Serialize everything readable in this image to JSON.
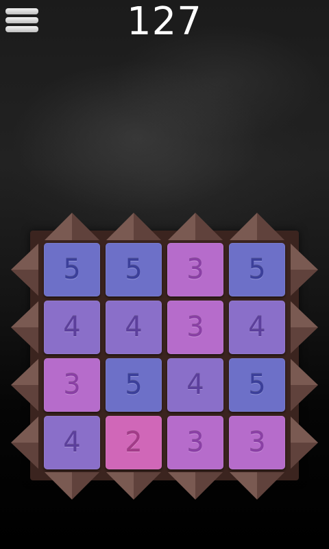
{
  "score": "127",
  "colors": {
    "frame": "#3b241f",
    "arrow": "#7a5a52",
    "arrow_dark": "#4a302a"
  },
  "board": {
    "rows": [
      [
        {
          "value": "5",
          "bg": "#6d70c8",
          "fg": "#3b3f9a"
        },
        {
          "value": "5",
          "bg": "#6d70c8",
          "fg": "#3b3f9a"
        },
        {
          "value": "3",
          "bg": "#b66ccb",
          "fg": "#8a3fa5"
        },
        {
          "value": "5",
          "bg": "#6d70c8",
          "fg": "#3b3f9a"
        }
      ],
      [
        {
          "value": "4",
          "bg": "#8a6fc9",
          "fg": "#5c3f9c"
        },
        {
          "value": "4",
          "bg": "#8a6fc9",
          "fg": "#5c3f9c"
        },
        {
          "value": "3",
          "bg": "#b66ccb",
          "fg": "#8a3fa5"
        },
        {
          "value": "4",
          "bg": "#8a6fc9",
          "fg": "#5c3f9c"
        }
      ],
      [
        {
          "value": "3",
          "bg": "#b66ccb",
          "fg": "#8a3fa5"
        },
        {
          "value": "5",
          "bg": "#6d70c8",
          "fg": "#3b3f9a"
        },
        {
          "value": "4",
          "bg": "#8a6fc9",
          "fg": "#5c3f9c"
        },
        {
          "value": "5",
          "bg": "#6d70c8",
          "fg": "#3b3f9a"
        }
      ],
      [
        {
          "value": "4",
          "bg": "#8a6fc9",
          "fg": "#5c3f9c"
        },
        {
          "value": "2",
          "bg": "#d067b8",
          "fg": "#a23b88"
        },
        {
          "value": "3",
          "bg": "#b66ccb",
          "fg": "#8a3fa5"
        },
        {
          "value": "3",
          "bg": "#b66ccb",
          "fg": "#8a3fa5"
        }
      ]
    ]
  },
  "arrows": {
    "top": [
      "arrow-up-icon",
      "arrow-up-icon",
      "arrow-up-icon",
      "arrow-up-icon"
    ],
    "bottom": [
      "arrow-down-icon",
      "arrow-down-icon",
      "arrow-down-icon",
      "arrow-down-icon"
    ],
    "left": [
      "arrow-left-icon",
      "arrow-left-icon",
      "arrow-left-icon",
      "arrow-left-icon"
    ],
    "right": [
      "arrow-right-icon",
      "arrow-right-icon",
      "arrow-right-icon",
      "arrow-right-icon"
    ]
  },
  "menu_icon": "hamburger-menu-icon"
}
